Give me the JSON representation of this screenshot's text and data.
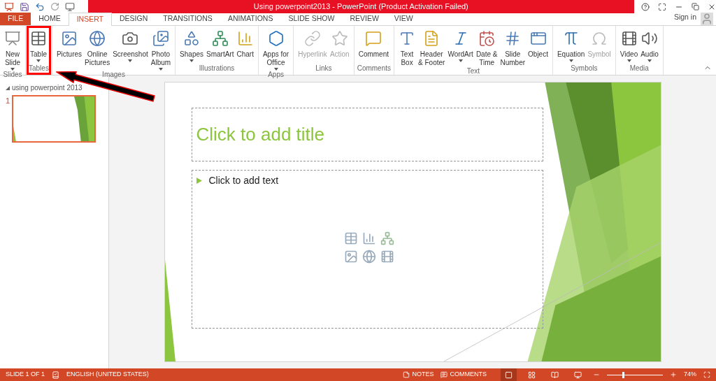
{
  "window": {
    "title": "Using powerpoint2013 -  PowerPoint (Product Activation Failed)"
  },
  "tabs": [
    {
      "label": "FILE",
      "kind": "file",
      "selected": false
    },
    {
      "label": "HOME",
      "kind": "tab",
      "selected": false
    },
    {
      "label": "INSERT",
      "kind": "tab",
      "selected": true
    },
    {
      "label": "DESIGN",
      "kind": "tab",
      "selected": false
    },
    {
      "label": "TRANSITIONS",
      "kind": "tab",
      "selected": false
    },
    {
      "label": "ANIMATIONS",
      "kind": "tab",
      "selected": false
    },
    {
      "label": "SLIDE SHOW",
      "kind": "tab",
      "selected": false
    },
    {
      "label": "REVIEW",
      "kind": "tab",
      "selected": false
    },
    {
      "label": "VIEW",
      "kind": "tab",
      "selected": false
    }
  ],
  "account": {
    "label": "Sign in"
  },
  "ribbon": [
    {
      "label": "Slides",
      "highlighted": false,
      "items": [
        {
          "lines": [
            "New",
            "Slide"
          ],
          "dropdown": true,
          "disabled": false
        }
      ]
    },
    {
      "label": "Tables",
      "highlighted": true,
      "items": [
        {
          "lines": [
            "Table"
          ],
          "dropdown": true,
          "disabled": false
        }
      ]
    },
    {
      "label": "Images",
      "highlighted": false,
      "items": [
        {
          "lines": [
            "Pictures"
          ],
          "dropdown": false,
          "disabled": false
        },
        {
          "lines": [
            "Online",
            "Pictures"
          ],
          "dropdown": false,
          "disabled": false
        },
        {
          "lines": [
            "Screenshot"
          ],
          "dropdown": true,
          "disabled": false
        },
        {
          "lines": [
            "Photo",
            "Album"
          ],
          "dropdown": true,
          "disabled": false
        }
      ]
    },
    {
      "label": "Illustrations",
      "highlighted": false,
      "items": [
        {
          "lines": [
            "Shapes"
          ],
          "dropdown": true,
          "disabled": false
        },
        {
          "lines": [
            "SmartArt"
          ],
          "dropdown": false,
          "disabled": false
        },
        {
          "lines": [
            "Chart"
          ],
          "dropdown": false,
          "disabled": false
        }
      ]
    },
    {
      "label": "Apps",
      "highlighted": false,
      "items": [
        {
          "lines": [
            "Apps for",
            "Office"
          ],
          "dropdown": true,
          "disabled": false
        }
      ]
    },
    {
      "label": "Links",
      "highlighted": false,
      "items": [
        {
          "lines": [
            "Hyperlink"
          ],
          "dropdown": false,
          "disabled": true
        },
        {
          "lines": [
            "Action"
          ],
          "dropdown": false,
          "disabled": true
        }
      ]
    },
    {
      "label": "Comments",
      "highlighted": false,
      "items": [
        {
          "lines": [
            "Comment"
          ],
          "dropdown": false,
          "disabled": false
        }
      ]
    },
    {
      "label": "Text",
      "highlighted": false,
      "items": [
        {
          "lines": [
            "Text",
            "Box"
          ],
          "dropdown": false,
          "disabled": false
        },
        {
          "lines": [
            "Header",
            "& Footer"
          ],
          "dropdown": false,
          "disabled": false
        },
        {
          "lines": [
            "WordArt"
          ],
          "dropdown": true,
          "disabled": false
        },
        {
          "lines": [
            "Date &",
            "Time"
          ],
          "dropdown": false,
          "disabled": false
        },
        {
          "lines": [
            "Slide",
            "Number"
          ],
          "dropdown": false,
          "disabled": false
        },
        {
          "lines": [
            "Object"
          ],
          "dropdown": false,
          "disabled": false
        }
      ]
    },
    {
      "label": "Symbols",
      "highlighted": false,
      "items": [
        {
          "lines": [
            "Equation"
          ],
          "dropdown": true,
          "disabled": false
        },
        {
          "lines": [
            "Symbol"
          ],
          "dropdown": false,
          "disabled": true
        }
      ]
    },
    {
      "label": "Media",
      "highlighted": false,
      "items": [
        {
          "lines": [
            "Video"
          ],
          "dropdown": true,
          "disabled": false
        },
        {
          "lines": [
            "Audio"
          ],
          "dropdown": true,
          "disabled": false
        }
      ]
    }
  ],
  "sidebar": {
    "section": "using powerpoint 2013",
    "thumbnails": [
      {
        "number": "1",
        "selected": true
      }
    ]
  },
  "slide": {
    "title_placeholder": "Click to add title",
    "text_placeholder": "Click to add text"
  },
  "status_bar": {
    "slide": "SLIDE 1 OF 1",
    "language": "ENGLISH (UNITED STATES)",
    "notes": "NOTES",
    "comments": "COMMENTS",
    "views": [
      {
        "selected": true
      },
      {
        "selected": false
      },
      {
        "selected": false
      },
      {
        "selected": false
      }
    ],
    "zoom": {
      "level": 0.28,
      "reading": "74%"
    }
  }
}
